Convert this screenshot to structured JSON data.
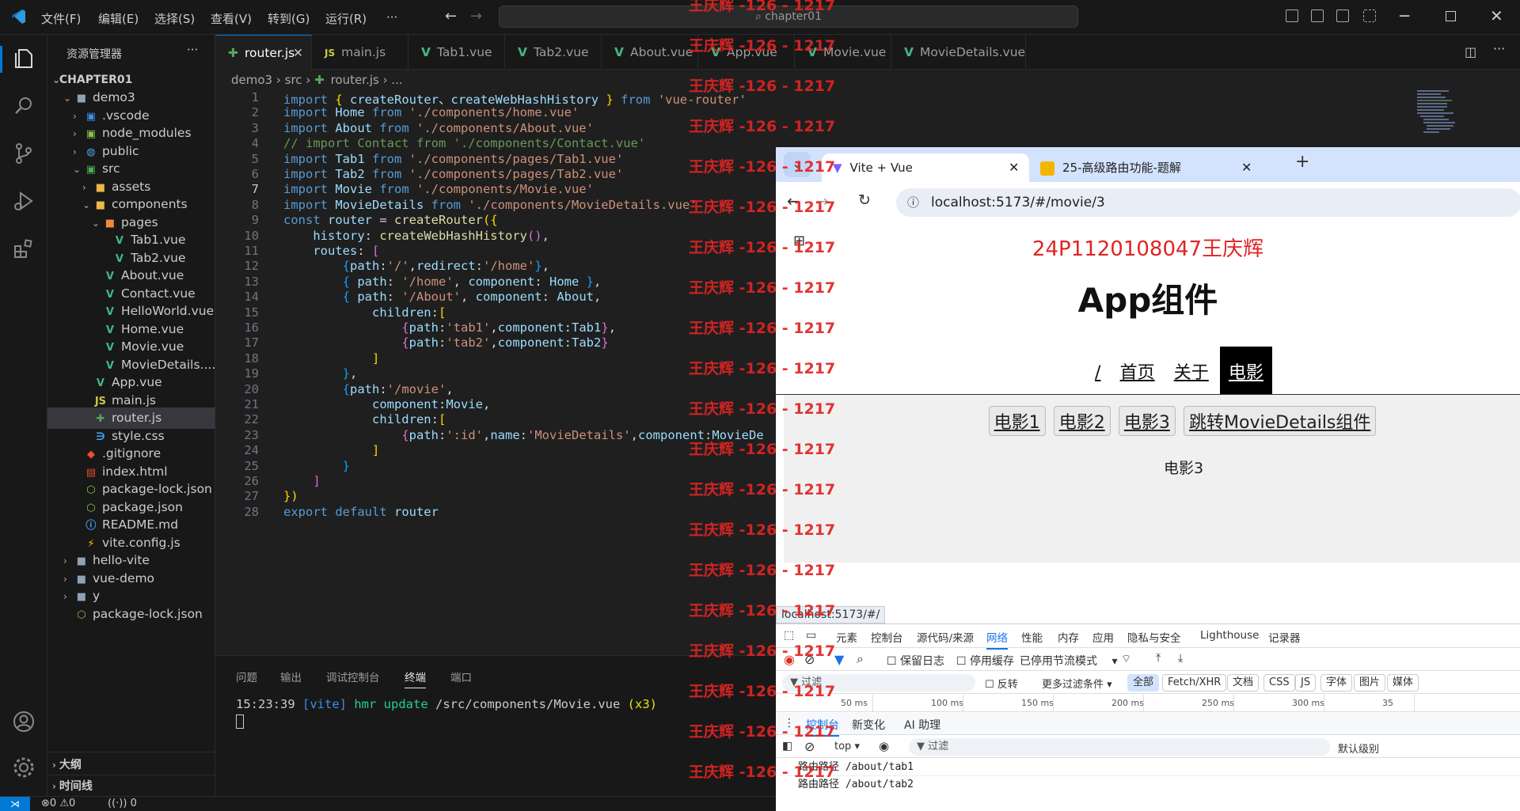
{
  "titlebar": {
    "menus": [
      "文件(F)",
      "编辑(E)",
      "选择(S)",
      "查看(V)",
      "转到(G)",
      "运行(R)",
      "···"
    ],
    "search": "chapter01"
  },
  "sidebar": {
    "title": "资源管理器",
    "more": "···",
    "root": "CHAPTER01",
    "items": [
      {
        "label": "demo3",
        "depth": 1,
        "kind": "folder",
        "open": true
      },
      {
        "label": ".vscode",
        "depth": 2,
        "kind": "folder-blue"
      },
      {
        "label": "node_modules",
        "depth": 2,
        "kind": "folder-green"
      },
      {
        "label": "public",
        "depth": 2,
        "kind": "folder-globe"
      },
      {
        "label": "src",
        "depth": 2,
        "kind": "folder-src",
        "open": true
      },
      {
        "label": "assets",
        "depth": 3,
        "kind": "folder-yellow"
      },
      {
        "label": "components",
        "depth": 3,
        "kind": "folder-yellow",
        "open": true
      },
      {
        "label": "pages",
        "depth": 4,
        "kind": "folder-orange",
        "open": true
      },
      {
        "label": "Tab1.vue",
        "depth": 5,
        "kind": "vue"
      },
      {
        "label": "Tab2.vue",
        "depth": 5,
        "kind": "vue"
      },
      {
        "label": "About.vue",
        "depth": 4,
        "kind": "vue"
      },
      {
        "label": "Contact.vue",
        "depth": 4,
        "kind": "vue"
      },
      {
        "label": "HelloWorld.vue",
        "depth": 4,
        "kind": "vue"
      },
      {
        "label": "Home.vue",
        "depth": 4,
        "kind": "vue"
      },
      {
        "label": "Movie.vue",
        "depth": 4,
        "kind": "vue"
      },
      {
        "label": "MovieDetails....",
        "depth": 4,
        "kind": "vue"
      },
      {
        "label": "App.vue",
        "depth": 3,
        "kind": "vue"
      },
      {
        "label": "main.js",
        "depth": 3,
        "kind": "js"
      },
      {
        "label": "router.js",
        "depth": 3,
        "kind": "router",
        "selected": true
      },
      {
        "label": "style.css",
        "depth": 3,
        "kind": "css"
      },
      {
        "label": ".gitignore",
        "depth": 2,
        "kind": "git"
      },
      {
        "label": "index.html",
        "depth": 2,
        "kind": "html"
      },
      {
        "label": "package-lock.json",
        "depth": 2,
        "kind": "npm"
      },
      {
        "label": "package.json",
        "depth": 2,
        "kind": "npm"
      },
      {
        "label": "README.md",
        "depth": 2,
        "kind": "info"
      },
      {
        "label": "vite.config.js",
        "depth": 2,
        "kind": "vite"
      },
      {
        "label": "hello-vite",
        "depth": 1,
        "kind": "folder"
      },
      {
        "label": "vue-demo",
        "depth": 1,
        "kind": "folder"
      },
      {
        "label": "y",
        "depth": 1,
        "kind": "folder"
      },
      {
        "label": "package-lock.json",
        "depth": 1,
        "kind": "npm"
      }
    ],
    "outline": "大纲",
    "timeline": "时间线"
  },
  "editor_tabs": [
    {
      "label": "router.js",
      "kind": "router",
      "active": true
    },
    {
      "label": "main.js",
      "kind": "js"
    },
    {
      "label": "Tab1.vue",
      "kind": "vue"
    },
    {
      "label": "Tab2.vue",
      "kind": "vue"
    },
    {
      "label": "About.vue",
      "kind": "vue"
    },
    {
      "label": "App.vue",
      "kind": "vue"
    },
    {
      "label": "Movie.vue",
      "kind": "vue"
    },
    {
      "label": "MovieDetails.vue",
      "kind": "vue"
    }
  ],
  "breadcrumb": {
    "p1": "demo3",
    "p2": "src",
    "p3": "router.js",
    "p4": "..."
  },
  "code": [
    [
      [
        "k",
        "import "
      ],
      [
        "y",
        "{ "
      ],
      [
        "v",
        "createRouter"
      ],
      [
        "",
        "、"
      ],
      [
        "v",
        "createWebHashHistory"
      ],
      [
        "y",
        " } "
      ],
      [
        "k",
        "from "
      ],
      [
        "s",
        "'vue-router'"
      ]
    ],
    [
      [
        "k",
        "import "
      ],
      [
        "v",
        "Home "
      ],
      [
        "k",
        "from "
      ],
      [
        "s",
        "'./components/home.vue'"
      ]
    ],
    [
      [
        "k",
        "import "
      ],
      [
        "v",
        "About "
      ],
      [
        "k",
        "from "
      ],
      [
        "s",
        "'./components/About.vue'"
      ]
    ],
    [
      [
        "c",
        "// import Contact from './components/Contact.vue'"
      ]
    ],
    [
      [
        "k",
        "import "
      ],
      [
        "v",
        "Tab1 "
      ],
      [
        "k",
        "from "
      ],
      [
        "s",
        "'./components/pages/Tab1.vue'"
      ]
    ],
    [
      [
        "k",
        "import "
      ],
      [
        "v",
        "Tab2 "
      ],
      [
        "k",
        "from "
      ],
      [
        "s",
        "'./components/pages/Tab2.vue'"
      ]
    ],
    [
      [
        "k",
        "import "
      ],
      [
        "v",
        "Movie "
      ],
      [
        "k",
        "from "
      ],
      [
        "s",
        "'./components/Movie.vue'"
      ]
    ],
    [
      [
        "k",
        "import "
      ],
      [
        "v",
        "MovieDetails "
      ],
      [
        "k",
        "from "
      ],
      [
        "s",
        "'./components/MovieDetails.vue'"
      ]
    ],
    [
      [
        "k",
        "const "
      ],
      [
        "v",
        "router "
      ],
      [
        "",
        "= "
      ],
      [
        "f",
        "createRouter"
      ],
      [
        "y",
        "({"
      ]
    ],
    [
      [
        "",
        "    "
      ],
      [
        "v",
        "history"
      ],
      [
        "",
        ": "
      ],
      [
        "f",
        "createWebHashHistory"
      ],
      [
        "p",
        "()"
      ],
      [
        "",
        ","
      ]
    ],
    [
      [
        "",
        "    "
      ],
      [
        "v",
        "routes"
      ],
      [
        "",
        ": "
      ],
      [
        "p",
        "["
      ]
    ],
    [
      [
        "",
        "        "
      ],
      [
        "b",
        "{"
      ],
      [
        "v",
        "path"
      ],
      [
        "",
        ":"
      ],
      [
        "s",
        "'/'"
      ],
      [
        "",
        ","
      ],
      [
        "v",
        "redirect"
      ],
      [
        "",
        ":"
      ],
      [
        "s",
        "'/home'"
      ],
      [
        "b",
        "}"
      ],
      [
        "",
        ","
      ]
    ],
    [
      [
        "",
        "        "
      ],
      [
        "b",
        "{ "
      ],
      [
        "v",
        "path"
      ],
      [
        "",
        ": "
      ],
      [
        "s",
        "'/home'"
      ],
      [
        "",
        ", "
      ],
      [
        "v",
        "component"
      ],
      [
        "",
        ": "
      ],
      [
        "v",
        "Home "
      ],
      [
        "b",
        "}"
      ],
      [
        "",
        ","
      ]
    ],
    [
      [
        "",
        "        "
      ],
      [
        "b",
        "{ "
      ],
      [
        "v",
        "path"
      ],
      [
        "",
        ": "
      ],
      [
        "s",
        "'/About'"
      ],
      [
        "",
        ", "
      ],
      [
        "v",
        "component"
      ],
      [
        "",
        ": "
      ],
      [
        "v",
        "About"
      ],
      [
        "",
        ","
      ]
    ],
    [
      [
        "",
        "            "
      ],
      [
        "v",
        "children"
      ],
      [
        "",
        ":"
      ],
      [
        "y",
        "["
      ]
    ],
    [
      [
        "",
        "                "
      ],
      [
        "p",
        "{"
      ],
      [
        "v",
        "path"
      ],
      [
        "",
        ":"
      ],
      [
        "s",
        "'tab1'"
      ],
      [
        "",
        ","
      ],
      [
        "v",
        "component"
      ],
      [
        "",
        ":"
      ],
      [
        "v",
        "Tab1"
      ],
      [
        "p",
        "}"
      ],
      [
        "",
        ","
      ]
    ],
    [
      [
        "",
        "                "
      ],
      [
        "p",
        "{"
      ],
      [
        "v",
        "path"
      ],
      [
        "",
        ":"
      ],
      [
        "s",
        "'tab2'"
      ],
      [
        "",
        ","
      ],
      [
        "v",
        "component"
      ],
      [
        "",
        ":"
      ],
      [
        "v",
        "Tab2"
      ],
      [
        "p",
        "}"
      ]
    ],
    [
      [
        "",
        "            "
      ],
      [
        "y",
        "]"
      ]
    ],
    [
      [
        "",
        "        "
      ],
      [
        "b",
        "}"
      ],
      [
        "",
        ","
      ]
    ],
    [
      [
        "",
        "        "
      ],
      [
        "b",
        "{"
      ],
      [
        "v",
        "path"
      ],
      [
        "",
        ":"
      ],
      [
        "s",
        "'/movie'"
      ],
      [
        "",
        ","
      ]
    ],
    [
      [
        "",
        "            "
      ],
      [
        "v",
        "component"
      ],
      [
        "",
        ":"
      ],
      [
        "v",
        "Movie"
      ],
      [
        "",
        ","
      ]
    ],
    [
      [
        "",
        "            "
      ],
      [
        "v",
        "children"
      ],
      [
        "",
        ":"
      ],
      [
        "y",
        "["
      ]
    ],
    [
      [
        "",
        "                "
      ],
      [
        "p",
        "{"
      ],
      [
        "v",
        "path"
      ],
      [
        "",
        ":"
      ],
      [
        "s",
        "':id'"
      ],
      [
        "",
        ","
      ],
      [
        "v",
        "name"
      ],
      [
        "",
        ":"
      ],
      [
        "s",
        "'MovieDetails'"
      ],
      [
        "",
        ","
      ],
      [
        "v",
        "component"
      ],
      [
        "",
        ":"
      ],
      [
        "v",
        "MovieDe"
      ]
    ],
    [
      [
        "",
        "            "
      ],
      [
        "y",
        "]"
      ]
    ],
    [
      [
        "",
        "        "
      ],
      [
        "b",
        "}"
      ]
    ],
    [
      [
        "",
        "    "
      ],
      [
        "p",
        "]"
      ]
    ],
    [
      [
        "y",
        "})"
      ]
    ],
    [
      [
        "k",
        "export "
      ],
      [
        "k",
        "default "
      ],
      [
        "v",
        "router"
      ]
    ]
  ],
  "panel": {
    "tabs": [
      "问题",
      "输出",
      "调试控制台",
      "终端",
      "端口"
    ],
    "active_tab": "终端",
    "log_time": "15:23:39",
    "log_tag": "[vite]",
    "log_msg": "hmr update",
    "log_path": "/src/components/Movie.vue",
    "log_count": "(x3)"
  },
  "status": {
    "errors": "0",
    "warnings": "0",
    "ports": "0"
  },
  "watermark": "王庆辉 -126 - 1217",
  "browser": {
    "tab1": "Vite + Vue",
    "tab2": "25-高级路由功能-题解",
    "url": "localhost:5173/#/movie/3",
    "student": "24P1120108047王庆辉",
    "app_title": "App组件",
    "nav": [
      "/",
      "首页",
      "关于",
      "电影"
    ],
    "nav_active": "电影",
    "movie_buttons": [
      "电影1",
      "电影2",
      "电影3",
      "跳转MovieDetails组件"
    ],
    "movie_text": "电影3",
    "hover_url": "localhost:5173/#/"
  },
  "devtools": {
    "tabs": [
      "元素",
      "控制台",
      "源代码/来源",
      "网络",
      "性能",
      "内存",
      "应用",
      "隐私与安全",
      "Lighthouse",
      "记录器"
    ],
    "active": "网络",
    "preserve_log": "保留日志",
    "disable_cache": "停用缓存",
    "throttle": "已停用节流模式",
    "filter": "过滤",
    "invert": "反转",
    "more_filters": "更多过滤条件",
    "types": [
      "全部",
      "Fetch/XHR",
      "文档",
      "CSS",
      "JS",
      "字体",
      "图片",
      "媒体"
    ],
    "timeline": [
      "50 ms",
      "100 ms",
      "150 ms",
      "200 ms",
      "250 ms",
      "300 ms",
      "35"
    ],
    "drawer_tabs": [
      "控制台",
      "新变化",
      "AI 助理"
    ],
    "context": "top",
    "console_filter": "过滤",
    "level": "默认级别",
    "logs": [
      "路由路径 /about/tab1",
      "路由路径 /about/tab2"
    ]
  },
  "colors": {
    "accent": "#0078d4",
    "vue": "#41b883",
    "watermark": "#e02424"
  }
}
